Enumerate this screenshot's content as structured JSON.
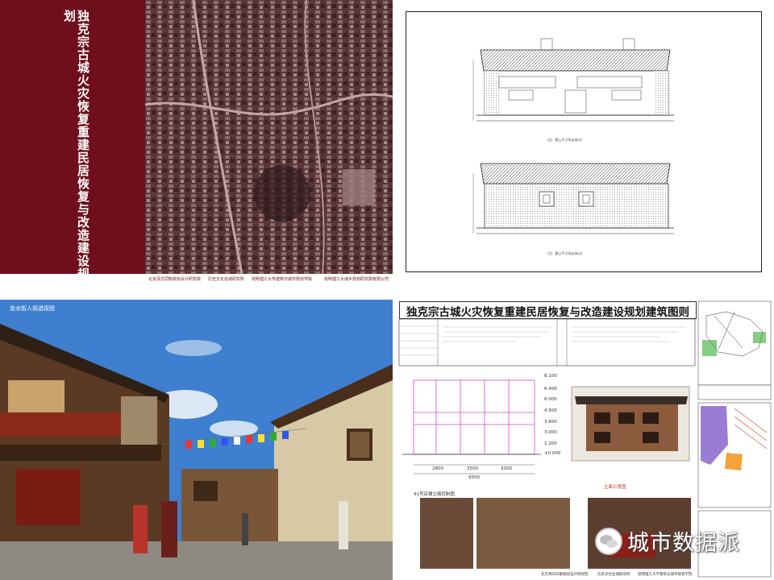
{
  "panel1": {
    "title": "独克宗古城火灾恢复重建民居恢复与改造建设规划",
    "footer": [
      "北京清华同衡规划设计研究院",
      "历史文化名城研究所",
      "昆明理工大学建筑与城市规划学院",
      "昆明理工大城乡规划研究院有限公司"
    ]
  },
  "panel2": {
    "caption_top": "(注：图上尺寸均以米计)",
    "caption_bottom": "(注：图上尺寸均以米计)"
  },
  "panel3": {
    "label": "金龙街人视透视图"
  },
  "panel4": {
    "title": "独克宗古城火灾恢复重建民居恢复与改造建设规划建筑图则",
    "elevation_label": "91号店铺立面控制图",
    "photo_label": "立面示意图",
    "dims_bottom": [
      "2800",
      "3500",
      "3200"
    ],
    "total_width": "9500",
    "heights": [
      "8.100",
      "6.400",
      "6.000",
      "4.500",
      "3.600",
      "3.000",
      "1.200",
      "±0.000"
    ],
    "footer": [
      "北京清华同衡规划设计研究院",
      "历史文化名城研究所",
      "昆明理工大学建筑与城市规划学院"
    ]
  },
  "watermark": {
    "text": "城市数据派"
  }
}
